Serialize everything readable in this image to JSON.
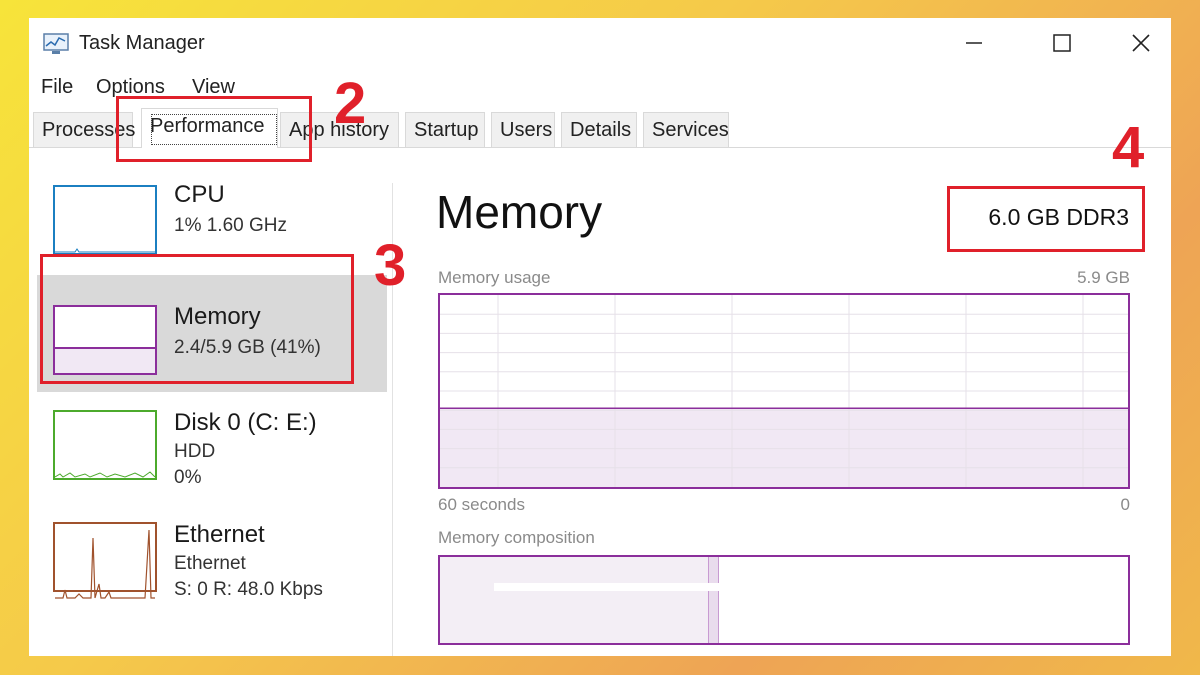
{
  "window": {
    "title": "Task Manager",
    "icon": "task-manager-icon"
  },
  "window_controls": [
    "minimize-icon",
    "maximize-icon",
    "close-icon"
  ],
  "menu": [
    {
      "label": "File"
    },
    {
      "label": "Options"
    },
    {
      "label": "View"
    }
  ],
  "tabs": [
    {
      "label": "Processes"
    },
    {
      "label": "Performance",
      "active": true
    },
    {
      "label": "App history"
    },
    {
      "label": "Startup"
    },
    {
      "label": "Users"
    },
    {
      "label": "Details"
    },
    {
      "label": "Services"
    }
  ],
  "sidebar": {
    "items": [
      {
        "title": "CPU",
        "line1": "1% 1.60 GHz",
        "line2": "",
        "color": "#1b7fc1"
      },
      {
        "title": "Memory",
        "line1": "2.4/5.9 GB (41%)",
        "line2": "",
        "color": "#8b2e9b",
        "selected": true
      },
      {
        "title": "Disk 0 (C: E:)",
        "line1": "HDD",
        "line2": "0%",
        "color": "#4caa2c"
      },
      {
        "title": "Ethernet",
        "line1": "Ethernet",
        "line2": "S: 0 R: 48.0 Kbps",
        "color": "#a0522d"
      }
    ]
  },
  "main": {
    "title": "Memory",
    "spec": "6.0 GB DDR3",
    "usage_label": "Memory usage",
    "usage_max": "5.9 GB",
    "axis_left": "60 seconds",
    "axis_right": "0",
    "composition_label": "Memory composition",
    "usage_fraction": 0.41
  },
  "annotations": [
    {
      "label": "2"
    },
    {
      "label": "3"
    },
    {
      "label": "4"
    }
  ],
  "colors": {
    "memory_accent": "#8b2e9b",
    "annotation_red": "#e0202a",
    "selected_bg": "#d9d9d9"
  }
}
